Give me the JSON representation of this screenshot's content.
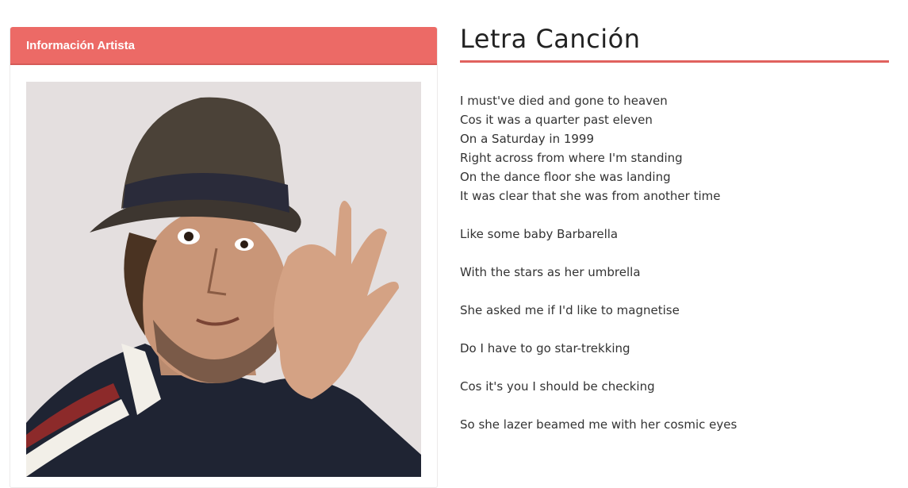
{
  "artist_panel": {
    "header_label": "Información Artista",
    "photo_alt": "Foto del artista"
  },
  "lyrics": {
    "title": "Letra Canción",
    "stanzas": [
      [
        "I must've died and gone to heaven",
        "Cos it was a quarter past eleven",
        "On a Saturday in 1999",
        "Right across from where I'm standing",
        "On the dance floor she was landing",
        "It was clear that she was from another time"
      ],
      [
        "Like some baby Barbarella"
      ],
      [
        "With the stars as her umbrella"
      ],
      [
        "She asked me if I'd like to magnetise"
      ],
      [
        "Do I have to go star-trekking"
      ],
      [
        "Cos it's you I should be checking"
      ],
      [
        "So she lazer beamed me with her cosmic eyes"
      ]
    ]
  },
  "colors": {
    "accent": "#ec6a66",
    "rule": "#e0625e"
  }
}
